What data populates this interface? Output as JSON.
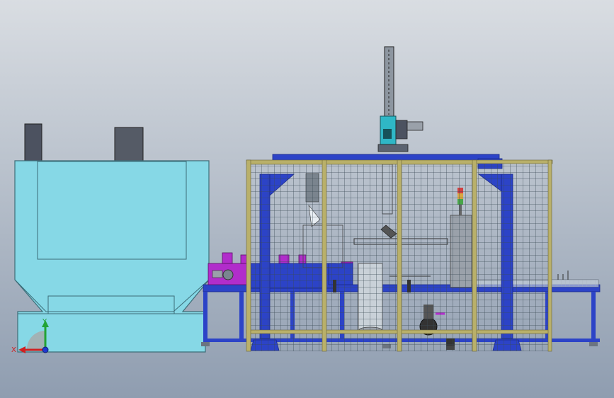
{
  "viewport": {
    "background_top": "#d9dde2",
    "background_bottom": "#8f9db0"
  },
  "colors": {
    "cabinet": "#86d8e6",
    "cabinet_edge": "#3c6d78",
    "chimney": "#4c5260",
    "frame_blue": "#2c43c7",
    "frame_blue_dark": "#1a2a8a",
    "fence_post": "#b9b06a",
    "mesh": "#3a4a55",
    "magenta": "#b12dcb",
    "robot_teal": "#2fb7c6",
    "conveyor": "#c5d0dc",
    "tower_gray": "#9aa1aa"
  },
  "icons": {
    "triad": "xyz-axis-triad-icon"
  },
  "triad": {
    "x_label": "X",
    "y_label": "Y"
  }
}
